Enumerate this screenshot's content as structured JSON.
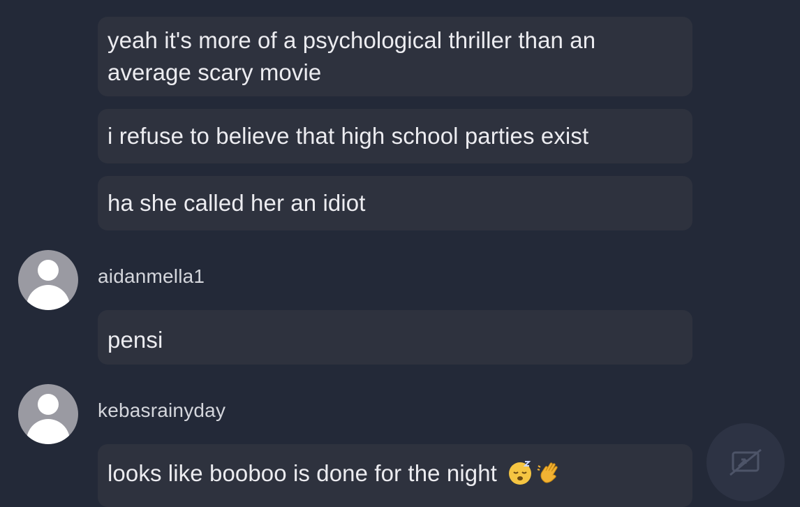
{
  "chat": {
    "messages": [
      {
        "text": "yeah it's more of a psychological thriller than an average scary movie"
      },
      {
        "text": "i refuse to believe that high school parties exist"
      },
      {
        "text": "ha she called her an idiot"
      },
      {
        "author": "aidanmella1",
        "text": "pensi"
      },
      {
        "author": "kebasrainyday",
        "text": "looks like booboo is done for the night",
        "emojis": [
          "sleeping-face-icon",
          "waving-hand-icon"
        ]
      }
    ]
  },
  "controls": {
    "cast_button_icon": "screen-share-off-icon"
  }
}
